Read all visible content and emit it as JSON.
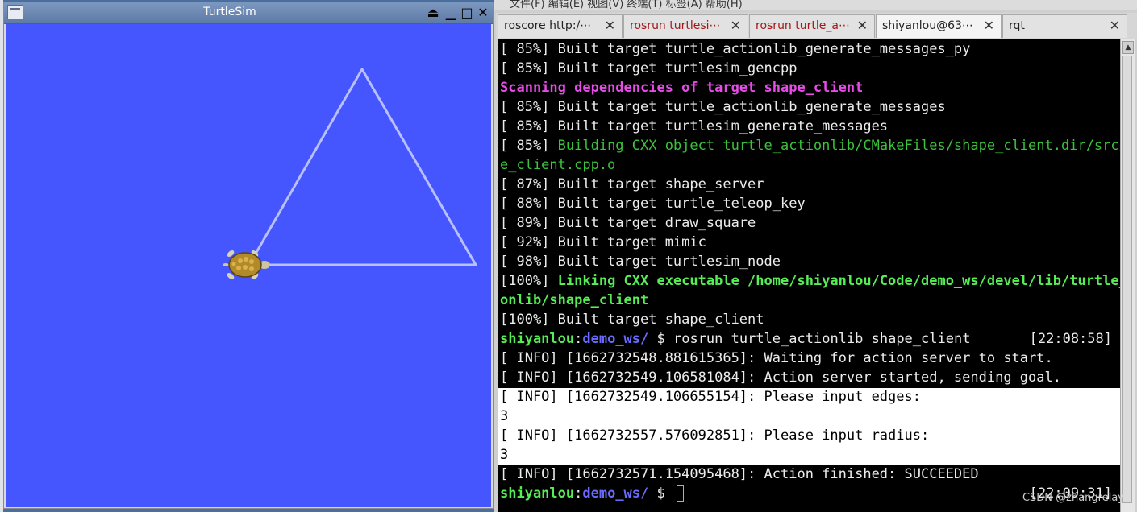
{
  "turtlesim": {
    "title": "TurtleSim",
    "bg_color": "#4556ff",
    "path_color": "#b9c0ff"
  },
  "top_menu": {
    "text": "文件(F)    编辑(E)    视图(V)    终端(T)    标签(A)    帮助(H)"
  },
  "terminal": {
    "tabs": [
      {
        "label": "roscore http:/⋯",
        "style": "normal"
      },
      {
        "label": "rosrun turtlesi⋯",
        "style": "red"
      },
      {
        "label": "rosrun turtle_a⋯",
        "style": "red"
      },
      {
        "label": "shiyanlou@63⋯",
        "style": "active"
      },
      {
        "label": "rqt",
        "style": "normal"
      }
    ],
    "lines": {
      "l1": "[ 85%] Built target turtle_actionlib_generate_messages_py",
      "l2": "[ 85%] Built target turtlesim_gencpp",
      "l3": "Scanning dependencies of target shape_client",
      "l4": "[ 85%] Built target turtle_actionlib_generate_messages",
      "l5": "[ 85%] Built target turtlesim_generate_messages",
      "l6a": "[ 85%] ",
      "l6b": "Building CXX object turtle_actionlib/CMakeFiles/shape_client.dir/src/shap",
      "l7": "e_client.cpp.o",
      "l8": "[ 87%] Built target shape_server",
      "l9": "[ 88%] Built target turtle_teleop_key",
      "l10": "[ 89%] Built target draw_square",
      "l11": "[ 92%] Built target mimic",
      "l12": "[ 98%] Built target turtlesim_node",
      "l13a": "[100%] ",
      "l13b": "Linking CXX executable /home/shiyanlou/Code/demo_ws/devel/lib/turtle_acti",
      "l14": "onlib/shape_client",
      "l15": "[100%] Built target shape_client",
      "prompt_user": "shiyanlou",
      "prompt_colon": ":",
      "prompt_dir": "demo_ws/",
      "prompt_sym": " $ ",
      "cmd": "rosrun turtle_actionlib shape_client",
      "time1": "[22:08:58]",
      "l17": "[ INFO] [1662732548.881615365]: Waiting for action server to start.",
      "l18": "[ INFO] [1662732549.106581084]: Action server started, sending goal.",
      "l19": "[ INFO] [1662732549.106655154]: Please input edges:",
      "l20": "3",
      "l21": "[ INFO] [1662732557.576092851]: Please input radius:",
      "l22": "3",
      "l23": "[ INFO] [1662732571.154095468]: Action finished: SUCCEEDED",
      "time2": "[22:09:31]"
    }
  },
  "watermark": "CSDN @zhangrelay",
  "icons": {
    "tab_close": "✕",
    "minimize": "▁",
    "maximize": "□",
    "close": "✕",
    "shade": "⏏"
  }
}
